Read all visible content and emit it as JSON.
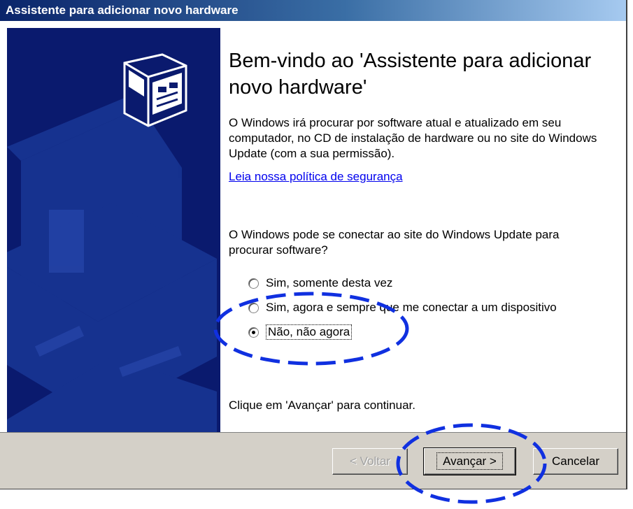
{
  "window": {
    "title": "Assistente para adicionar novo hardware"
  },
  "main": {
    "heading": "Bem-vindo ao 'Assistente para adicionar novo hardware'",
    "intro": "O Windows irá procurar por software atual e atualizado em seu computador, no CD de instalação de hardware ou no site do Windows Update (com a sua permissão).",
    "privacy_link": "Leia nossa política de segurança",
    "question": "O Windows pode se conectar ao site do Windows Update para procurar software?",
    "options": [
      {
        "label": "Sim, somente desta vez",
        "checked": false
      },
      {
        "label": "Sim, agora e sempre que me conectar a um dispositivo",
        "checked": false
      },
      {
        "label": "Não, não agora",
        "checked": true
      }
    ],
    "continue_hint": "Clique em 'Avançar' para continuar."
  },
  "buttons": {
    "back": "< Voltar",
    "next": "Avançar >",
    "cancel": "Cancelar"
  },
  "colors": {
    "titlebar": "#0a246a",
    "side_panel": "#0a1a6e",
    "annotation": "#1030e0",
    "dialog_face": "#d4d0c8"
  },
  "icons": {
    "wizard_image": "hardware-card-icon"
  }
}
